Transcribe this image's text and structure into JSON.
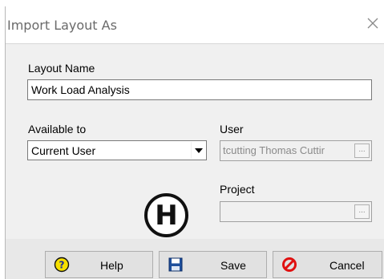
{
  "dialog": {
    "title": "Import Layout As"
  },
  "layout_name": {
    "label": "Layout Name",
    "value": "Work Load Analysis"
  },
  "available_to": {
    "label": "Available to",
    "selected": "Current User"
  },
  "user": {
    "label": "User",
    "value": "tcutting Thomas Cuttir",
    "browse": "..."
  },
  "project": {
    "label": "Project",
    "value": "",
    "browse": "..."
  },
  "marker": {
    "letter": "H"
  },
  "buttons": {
    "help": "Help",
    "save": "Save",
    "cancel": "Cancel"
  },
  "icons": {
    "close": "close-icon",
    "help": "help-icon",
    "save": "floppy-disk-icon",
    "cancel": "cancel-icon",
    "dropdown": "chevron-down-icon"
  }
}
